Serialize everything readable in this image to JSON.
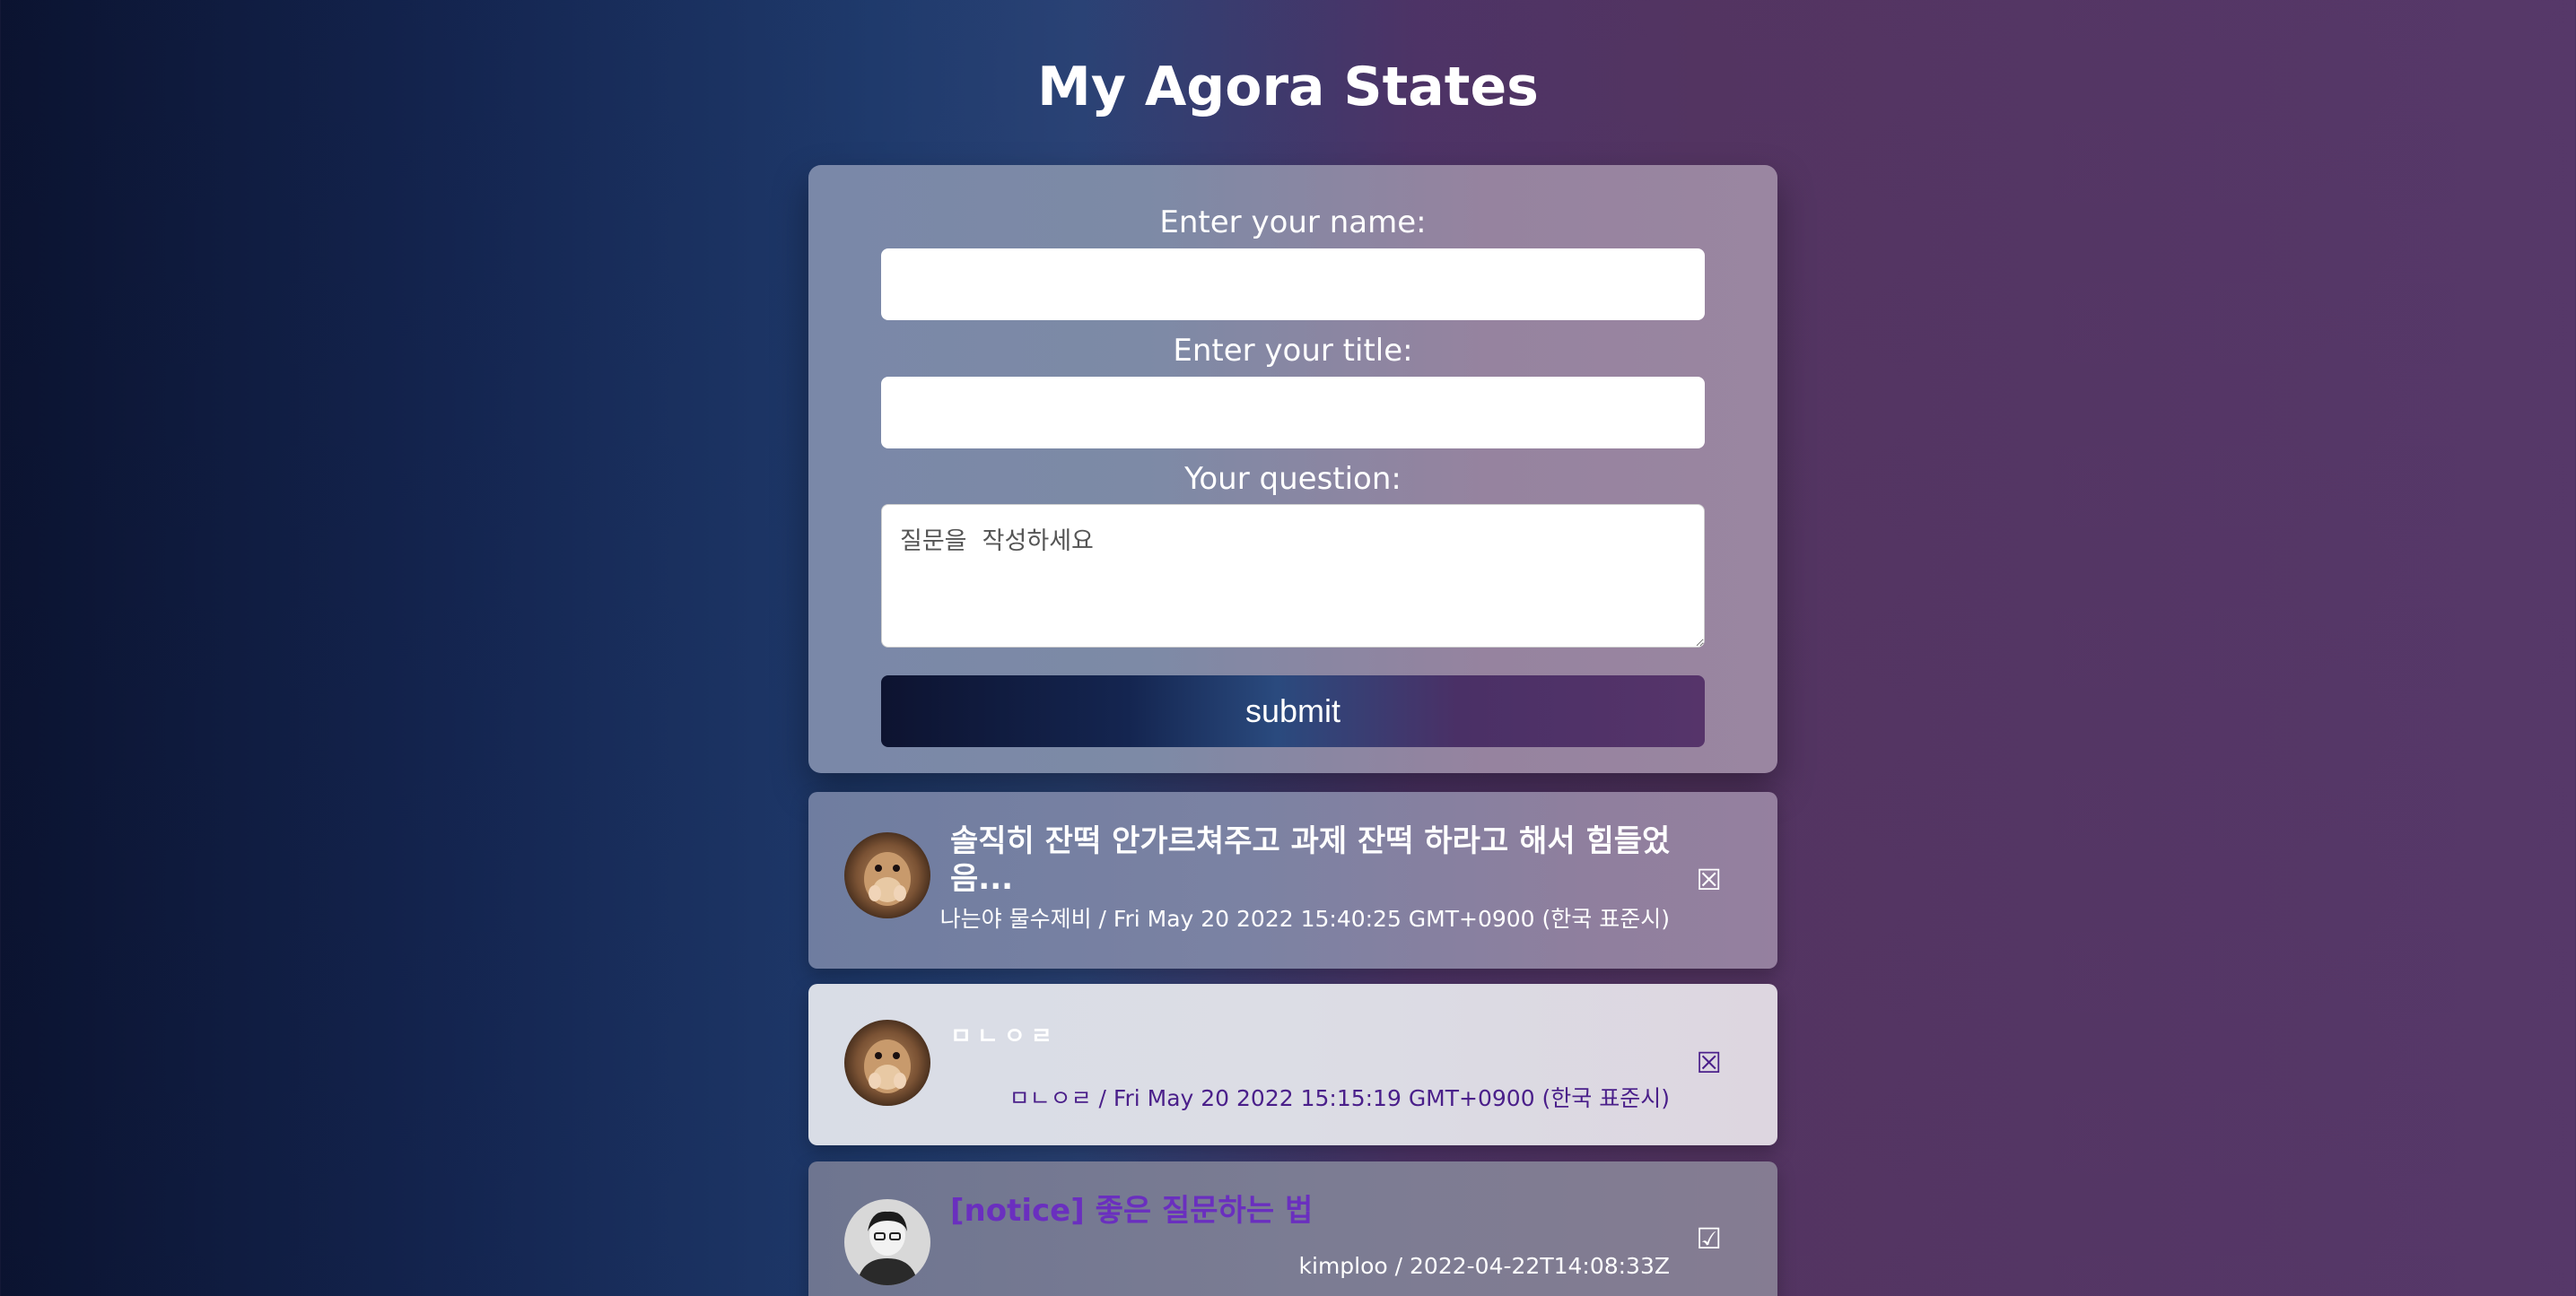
{
  "page": {
    "title": "My Agora States"
  },
  "form": {
    "name_label": "Enter your name:",
    "name_value": "",
    "title_label": "Enter your title:",
    "title_value": "",
    "question_label": "Your question:",
    "question_placeholder": "질문을  작성하세요",
    "submit_label": "submit"
  },
  "discussions": [
    {
      "title": "솔직히 잔떡 안가르쳐주고 과제 잔떡 하라고 해서 힘들었음...",
      "meta": "나는야 물수제비 / Fri May 20 2022 15:40:25 GMT+0900 (한국 표준시)",
      "answer_icon": "☒",
      "answered": false,
      "avatar": "hamster-avatar"
    },
    {
      "title": "ㅁㄴㅇㄹ",
      "meta": "ㅁㄴㅇㄹ / Fri May 20 2022 15:15:19 GMT+0900 (한국 표준시)",
      "answer_icon": "☒",
      "answered": false,
      "avatar": "hamster-avatar"
    },
    {
      "title": "[notice] 좋은 질문하는 법",
      "meta": "kimploo / 2022-04-22T14:08:33Z",
      "answer_icon": "☑",
      "answered": true,
      "avatar": "person-avatar"
    }
  ],
  "colors": {
    "accent_purple": "#6a2fbf",
    "meta_dark": "#4a1f8a"
  }
}
